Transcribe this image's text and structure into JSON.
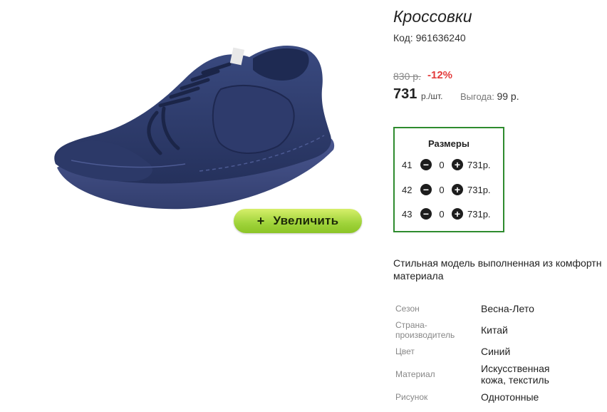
{
  "product": {
    "title": "Кроссовки",
    "code_label": "Код: 961636240",
    "old_price": "830 р.",
    "discount": "-12%",
    "price": "731",
    "price_unit": "р./шт.",
    "savings_label": "Выгода:",
    "savings_value": "99 р."
  },
  "image": {
    "zoom_button_label": "Увеличить",
    "zoom_button_icon": "+"
  },
  "sizes": {
    "title": "Размеры",
    "rows": [
      {
        "size": "41",
        "qty": "0",
        "price": "731р."
      },
      {
        "size": "42",
        "qty": "0",
        "price": "731р."
      },
      {
        "size": "43",
        "qty": "0",
        "price": "731р."
      }
    ]
  },
  "description": {
    "line1": "Стильная модель выполненная из комфортн",
    "line2": "материала"
  },
  "specs": [
    {
      "key": "Сезон",
      "value": "Весна-Лето"
    },
    {
      "key": "Страна-производитель",
      "value": "Китай"
    },
    {
      "key": "Цвет",
      "value": "Синий"
    },
    {
      "key": "Материал",
      "value": "Искусственная кожа, текстиль"
    },
    {
      "key": "Рисунок",
      "value": "Однотонные"
    }
  ],
  "colors": {
    "accent_green": "#2e8b2e",
    "discount_red": "#e33b3b",
    "button_green": "#9fd33a",
    "shoe_navy": "#2a3766"
  },
  "icons": {
    "minus": "minus-circle-icon",
    "plus": "plus-circle-icon"
  }
}
